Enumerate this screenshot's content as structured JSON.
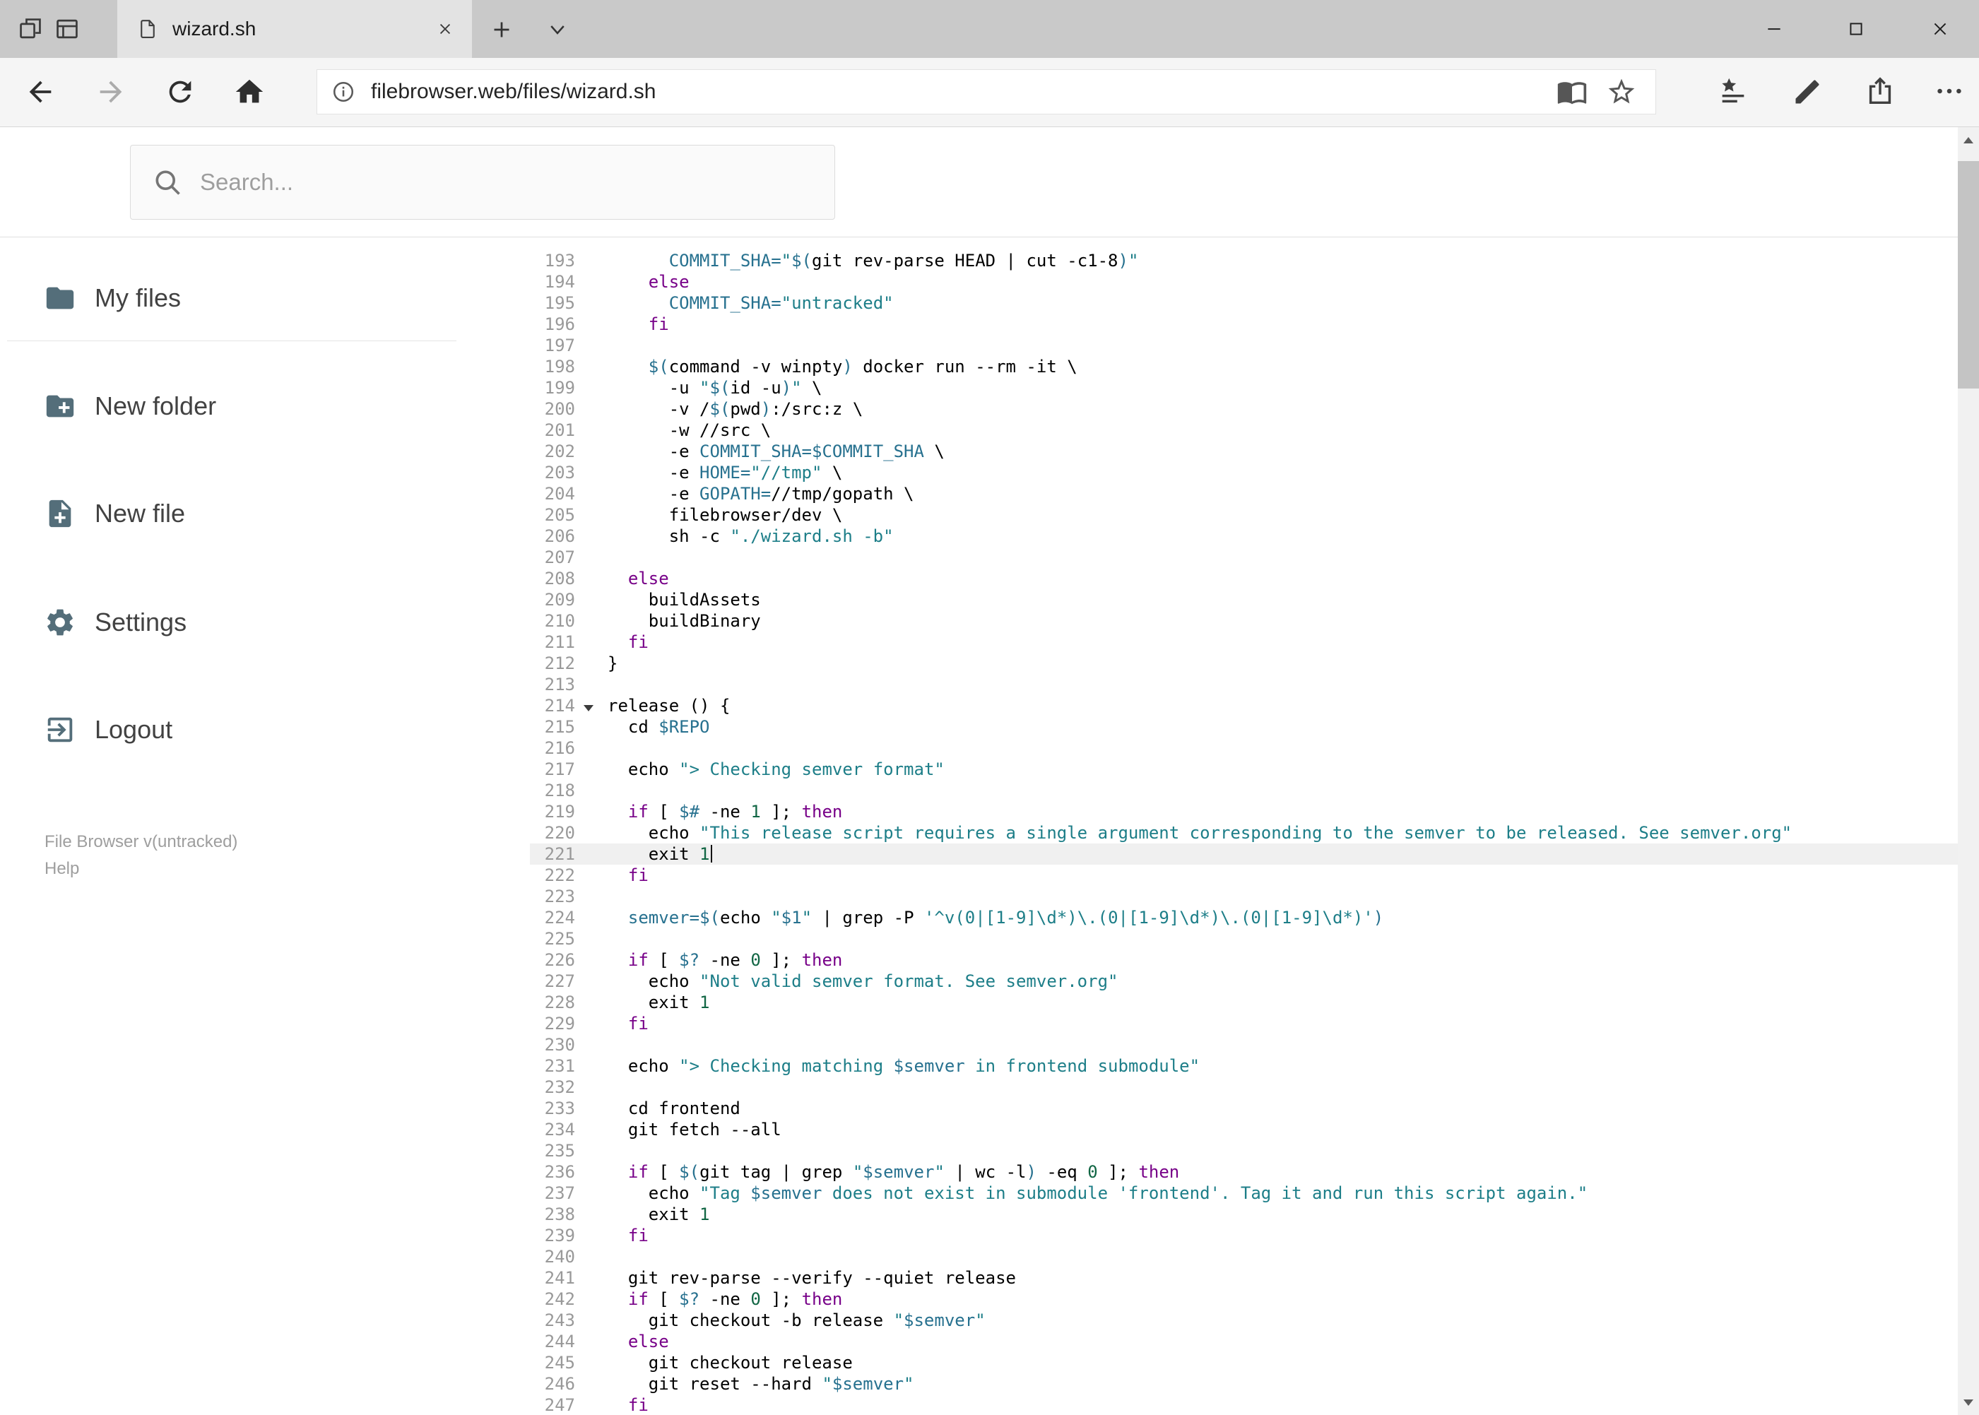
{
  "colors": {
    "accent": "#1976d2",
    "icon": "#546e7a"
  },
  "window": {
    "tab_title": "wizard.sh"
  },
  "navigation": {
    "url": "filebrowser.web/files/wizard.sh"
  },
  "app": {
    "search_placeholder": "Search...",
    "toolbar_icons": [
      "save",
      "share",
      "rename",
      "copy",
      "move",
      "delete",
      "code-view",
      "download",
      "info"
    ],
    "sidebar": {
      "items": [
        {
          "label": "My files",
          "icon": "folder-icon"
        },
        {
          "label": "New folder",
          "icon": "new-folder-icon"
        },
        {
          "label": "New file",
          "icon": "new-file-icon"
        },
        {
          "label": "Settings",
          "icon": "gear-icon"
        },
        {
          "label": "Logout",
          "icon": "logout-icon"
        }
      ],
      "footer_version": "File Browser v(untracked)",
      "footer_help": "Help"
    }
  },
  "editor": {
    "language": "shell",
    "first_line_number": 193,
    "active_line_number": 221,
    "cursor": {
      "line": 221,
      "column": 10
    },
    "folded_markers": [
      214
    ],
    "syntax_colors": {
      "keyword": "#770088",
      "string": "#1d7e88",
      "variable": "#27718f",
      "number": "#116644",
      "line_number": "#999999",
      "active_line_bg": "#f0f0f0"
    },
    "lines": [
      "      COMMIT_SHA=\"$(git rev-parse HEAD | cut -c1-8)\"",
      "    else",
      "      COMMIT_SHA=\"untracked\"",
      "    fi",
      "",
      "    $(command -v winpty) docker run --rm -it \\",
      "      -u \"$(id -u)\" \\",
      "      -v /$(pwd):/src:z \\",
      "      -w //src \\",
      "      -e COMMIT_SHA=$COMMIT_SHA \\",
      "      -e HOME=\"//tmp\" \\",
      "      -e GOPATH=//tmp/gopath \\",
      "      filebrowser/dev \\",
      "      sh -c \"./wizard.sh -b\"",
      "",
      "  else",
      "    buildAssets",
      "    buildBinary",
      "  fi",
      "}",
      "",
      "release () {",
      "  cd $REPO",
      "",
      "  echo \"> Checking semver format\"",
      "",
      "  if [ $# -ne 1 ]; then",
      "    echo \"This release script requires a single argument corresponding to the semver to be released. See semver.org\"",
      "    exit 1",
      "  fi",
      "",
      "  semver=$(echo \"$1\" | grep -P '^v(0|[1-9]\\d*)\\.(0|[1-9]\\d*)\\.(0|[1-9]\\d*)')",
      "",
      "  if [ $? -ne 0 ]; then",
      "    echo \"Not valid semver format. See semver.org\"",
      "    exit 1",
      "  fi",
      "",
      "  echo \"> Checking matching $semver in frontend submodule\"",
      "",
      "  cd frontend",
      "  git fetch --all",
      "",
      "  if [ $(git tag | grep \"$semver\" | wc -l) -eq 0 ]; then",
      "    echo \"Tag $semver does not exist in submodule 'frontend'. Tag it and run this script again.\"",
      "    exit 1",
      "  fi",
      "",
      "  git rev-parse --verify --quiet release",
      "  if [ $? -ne 0 ]; then",
      "    git checkout -b release \"$semver\"",
      "  else",
      "    git checkout release",
      "    git reset --hard \"$semver\"",
      "  fi"
    ]
  }
}
